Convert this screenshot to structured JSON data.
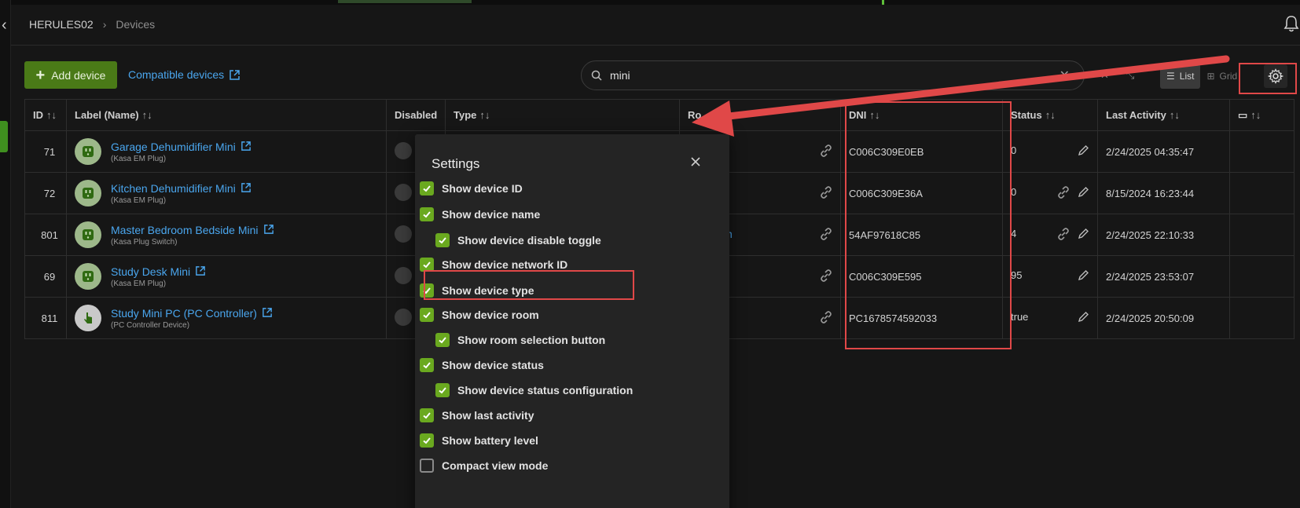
{
  "breadcrumb": {
    "hub": "HERULES02",
    "page": "Devices"
  },
  "toolbar": {
    "add_device": "Add device",
    "compatible_devices": "Compatible devices",
    "search_value": "mini",
    "view_list": "List",
    "view_grid": "Grid"
  },
  "table": {
    "headers": {
      "id": "ID",
      "label": "Label (Name)",
      "disabled": "Disabled",
      "type": "Type",
      "room": "Ro",
      "dni": "DNI",
      "status": "Status",
      "last_activity": "Last Activity"
    },
    "rows": [
      {
        "id": "71",
        "name": "Garage Dehumidifier Mini",
        "type": "(Kasa EM Plug)",
        "room": "",
        "dni": "C006C309E0EB",
        "status": "0",
        "last_activity": "2/24/2025 04:35:47"
      },
      {
        "id": "72",
        "name": "Kitchen Dehumidifier Mini",
        "type": "(Kasa EM Plug)",
        "room": "",
        "dni": "C006C309E36A",
        "status": "0",
        "last_activity": "8/15/2024 16:23:44"
      },
      {
        "id": "801",
        "name": "Master Bedroom Bedside Mini",
        "type": "(Kasa Plug Switch)",
        "room": "Bedroom",
        "dni": "54AF97618C85",
        "status": "4",
        "last_activity": "2/24/2025 22:10:33"
      },
      {
        "id": "69",
        "name": "Study Desk Mini",
        "type": "(Kasa EM Plug)",
        "room": "",
        "dni": "C006C309E595",
        "status": "95",
        "last_activity": "2/24/2025 23:53:07"
      },
      {
        "id": "811",
        "name": "Study Mini PC (PC Controller)",
        "type": "(PC Controller Device)",
        "room": "",
        "dni": "PC1678574592033",
        "status": "true",
        "last_activity": "2/24/2025 20:50:09"
      }
    ]
  },
  "settings": {
    "title": "Settings",
    "options": [
      {
        "label": "Show device ID",
        "checked": true
      },
      {
        "label": "Show device name",
        "checked": true
      },
      {
        "label": "Show device disable toggle",
        "checked": true
      },
      {
        "label": "Show device network ID",
        "checked": true
      },
      {
        "label": "Show device type",
        "checked": true
      },
      {
        "label": "Show device room",
        "checked": true
      },
      {
        "label": "Show room selection button",
        "checked": true
      },
      {
        "label": "Show device status",
        "checked": true
      },
      {
        "label": "Show device status configuration",
        "checked": true
      },
      {
        "label": "Show last activity",
        "checked": true
      },
      {
        "label": "Show battery level",
        "checked": true
      },
      {
        "label": "Compact view mode",
        "checked": false
      }
    ]
  },
  "colors": {
    "accent": "#4a7a17",
    "link": "#4aa6ee",
    "checkbox": "#6aa91f",
    "annotation": "#e04848"
  }
}
